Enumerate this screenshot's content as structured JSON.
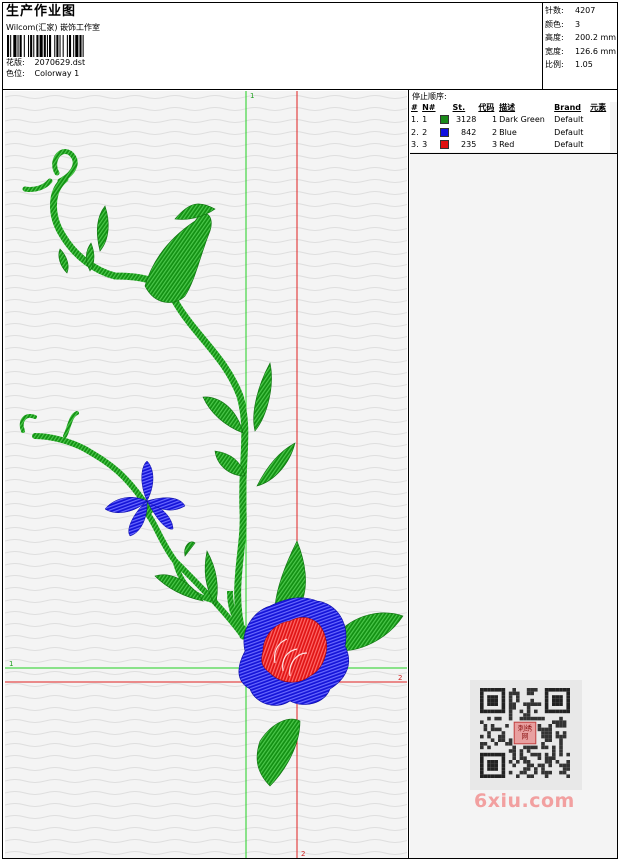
{
  "header": {
    "title": "生产作业图",
    "company": "Wilcom(汇家) 嵌饰工作室",
    "pattern_label": "花版:",
    "pattern_value": "2070629.dst",
    "colorway_label": "色位:",
    "colorway_value": "Colorway 1"
  },
  "stats": {
    "stitches_label": "针数:",
    "stitches_value": "4207",
    "colors_label": "颜色:",
    "colors_value": "3",
    "height_label": "高度:",
    "height_value": "200.2 mm",
    "width_label": "宽度:",
    "width_value": "126.6 mm",
    "ratio_label": "比例:",
    "ratio_value": "1.05"
  },
  "canvas": {
    "guide_v1_label": "1",
    "guide_h1_label": "1",
    "guide_v2_label": "2",
    "guide_h2_label": "2"
  },
  "stop_sequence": {
    "title": "停止顺序:",
    "headers": {
      "num": "#",
      "needle": "N#",
      "stitches": "St.",
      "code": "代码",
      "description": "描述",
      "brand": "Brand",
      "elements": "元素"
    },
    "rows": [
      {
        "num": "1.",
        "needle": "1",
        "color": "#1a8a1a",
        "stitches": "3128",
        "code": "1",
        "description": "Dark Green",
        "brand": "Default"
      },
      {
        "num": "2.",
        "needle": "2",
        "color": "#1010e0",
        "stitches": "842",
        "code": "2",
        "description": "Blue",
        "brand": "Default"
      },
      {
        "num": "3.",
        "needle": "3",
        "color": "#e01010",
        "stitches": "235",
        "code": "3",
        "description": "Red",
        "brand": "Default"
      }
    ]
  },
  "watermark": {
    "text": "6xiu.com",
    "qr_center_text": "刺绣\n网"
  },
  "colors": {
    "green": "#1a9a1a",
    "blue": "#1818e0",
    "red": "#e81818",
    "guide_green": "#20d020",
    "guide_red": "#e02020"
  }
}
